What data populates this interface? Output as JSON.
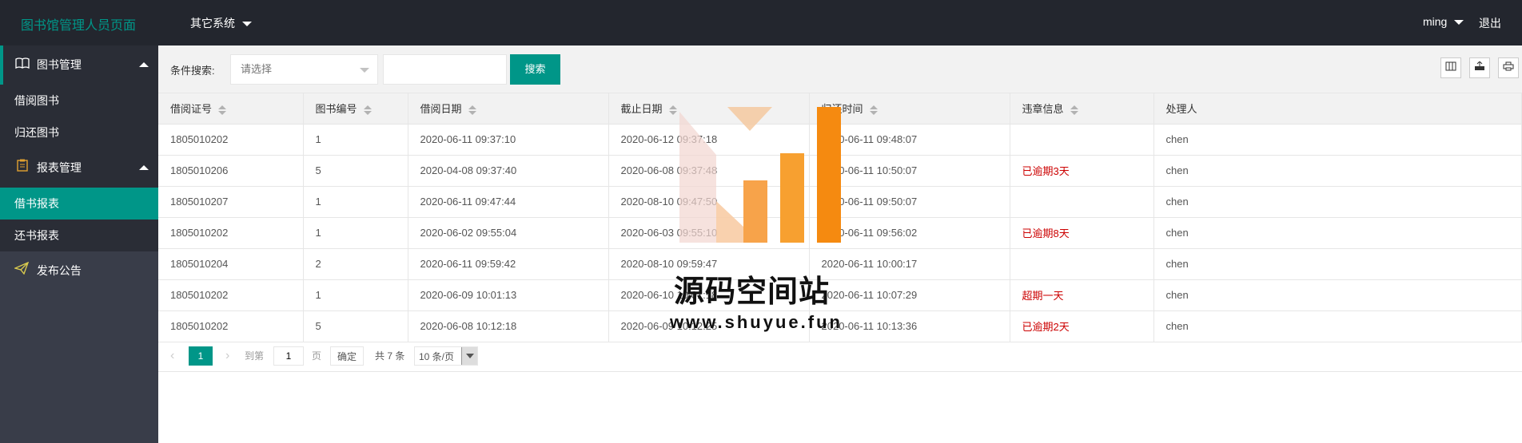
{
  "header": {
    "title": "图书馆管理人员页面",
    "other_systems": "其它系统",
    "user": "ming",
    "logout": "退出"
  },
  "sidebar": {
    "groups": [
      {
        "label": "图书管理",
        "icon": "book-icon",
        "items": [
          "借阅图书",
          "归还图书"
        ]
      },
      {
        "label": "报表管理",
        "icon": "clipboard-icon",
        "items": [
          "借书报表",
          "还书报表"
        ]
      }
    ],
    "plain": {
      "label": "发布公告",
      "icon": "paper-plane-icon"
    },
    "active_item": "借书报表"
  },
  "search": {
    "label": "条件搜索:",
    "select_placeholder": "请选择",
    "input_value": "",
    "button": "搜索"
  },
  "table": {
    "columns": [
      "借阅证号",
      "图书编号",
      "借阅日期",
      "截止日期",
      "归还时间",
      "违章信息",
      "处理人"
    ],
    "rows": [
      [
        "1805010202",
        "1",
        "2020-06-11 09:37:10",
        "2020-06-12 09:37:18",
        "2020-06-11 09:48:07",
        "",
        "chen"
      ],
      [
        "1805010206",
        "5",
        "2020-04-08 09:37:40",
        "2020-06-08 09:37:48",
        "2020-06-11 10:50:07",
        "已逾期3天",
        "chen"
      ],
      [
        "1805010207",
        "1",
        "2020-06-11 09:47:44",
        "2020-08-10 09:47:50",
        "2020-06-11 09:50:07",
        "",
        "chen"
      ],
      [
        "1805010202",
        "1",
        "2020-06-02 09:55:04",
        "2020-06-03 09:55:10",
        "2020-06-11 09:56:02",
        "已逾期8天",
        "chen"
      ],
      [
        "1805010204",
        "2",
        "2020-06-11 09:59:42",
        "2020-08-10 09:59:47",
        "2020-06-11 10:00:17",
        "",
        "chen"
      ],
      [
        "1805010202",
        "1",
        "2020-06-09 10:01:13",
        "2020-06-10 10:01:18",
        "2020-06-11 10:07:29",
        "超期一天",
        "chen"
      ],
      [
        "1805010202",
        "5",
        "2020-06-08 10:12:18",
        "2020-06-09 10:12:25",
        "2020-06-11 10:13:36",
        "已逾期2天",
        "chen"
      ]
    ]
  },
  "pagination": {
    "current": "1",
    "goto_label": "到第",
    "page_input": "1",
    "page_unit": "页",
    "confirm": "确定",
    "total": "共 7 条",
    "page_size": "10 条/页"
  },
  "watermark": {
    "text": "源码空间站",
    "url": "www.shuyue.fun"
  },
  "colors": {
    "header_bg": "#23262e",
    "sidebar_bg": "#393d49",
    "accent": "#009688",
    "overdue": "#cc0000"
  }
}
